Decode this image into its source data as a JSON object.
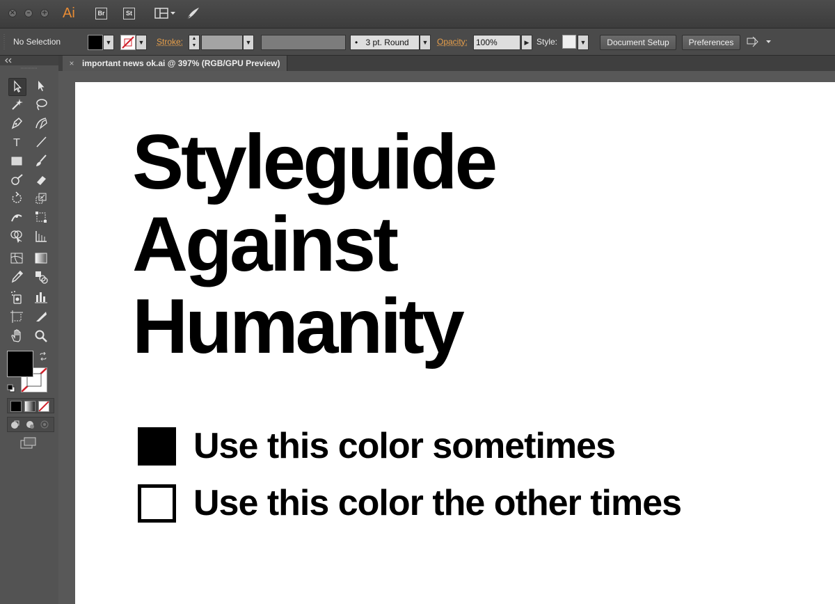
{
  "app": {
    "logo": "Ai",
    "bridge_badge": "Br",
    "stock_badge": "St",
    "icons": [
      "close-icon",
      "minimize-icon",
      "zoom-icon",
      "workspace-layout-icon",
      "brush-launch-icon"
    ]
  },
  "control_bar": {
    "selection_label": "No Selection",
    "fill_color": "#000000",
    "stroke_label": "Stroke:",
    "brush_value": "3 pt. Round",
    "opacity_label": "Opacity:",
    "opacity_value": "100%",
    "style_label": "Style:",
    "document_setup": "Document Setup",
    "preferences": "Preferences"
  },
  "document": {
    "tab_title": "important news ok.ai @ 397% (RGB/GPU Preview)",
    "headline_lines": [
      "Styleguide",
      "Against",
      "Humanity"
    ],
    "legend": [
      {
        "label": "Use this color sometimes",
        "color": "#000000"
      },
      {
        "label": "Use this color the other times",
        "color": "#ffffff"
      }
    ]
  },
  "tools": {
    "names": [
      "selection-tool",
      "direct-selection-tool",
      "magic-wand-tool",
      "lasso-tool",
      "pen-tool",
      "curvature-tool",
      "type-tool",
      "line-segment-tool",
      "rectangle-tool",
      "paintbrush-tool",
      "shaper-tool",
      "eraser-tool",
      "rotate-tool",
      "scale-tool",
      "width-tool",
      "free-transform-tool",
      "shape-builder-tool",
      "perspective-grid-tool",
      "mesh-tool",
      "gradient-tool",
      "eyedropper-tool",
      "blend-tool",
      "symbol-sprayer-tool",
      "column-graph-tool",
      "artboard-tool",
      "slice-tool",
      "hand-tool",
      "zoom-tool"
    ],
    "type_glyph": "T"
  },
  "colors": {
    "accent": "#e98c34",
    "panel": "#535353",
    "toolbar": "#4a4a4a"
  }
}
